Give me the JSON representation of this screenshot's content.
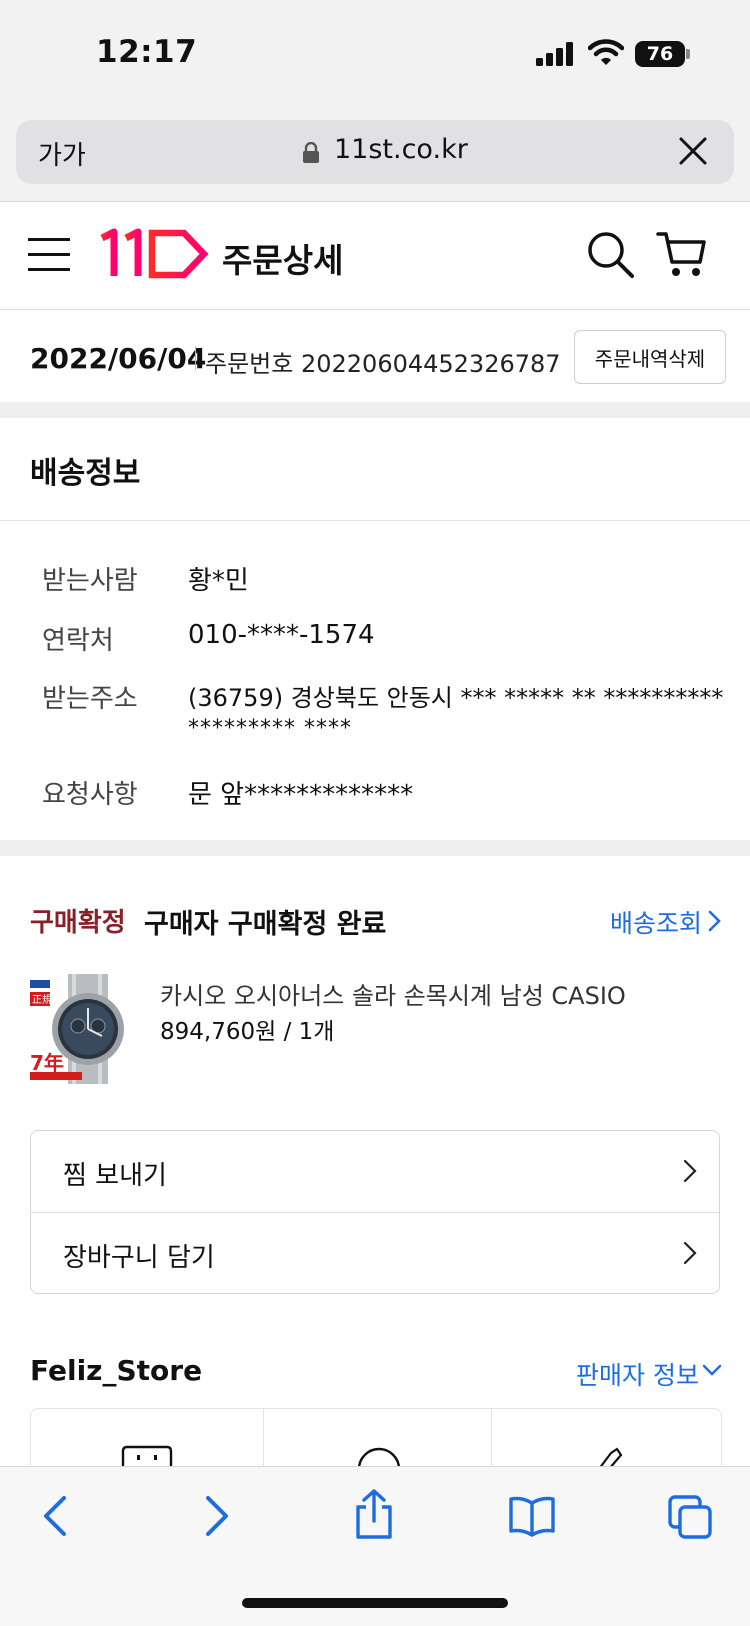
{
  "status": {
    "time": "12:17",
    "battery": "76"
  },
  "browser": {
    "text_size": "가가",
    "url": "11st.co.kr"
  },
  "header": {
    "title": "주문상세"
  },
  "order": {
    "date": "2022/06/04",
    "number_label": "주문번호",
    "number": "20220604452326787",
    "delete_button": "주문내역삭제"
  },
  "delivery": {
    "heading": "배송정보",
    "recipient_label": "받는사람",
    "recipient": "황*민",
    "phone_label": "연락처",
    "phone": "010-****-1574",
    "address_label": "받는주소",
    "address_line1": "(36759) 경상북도 안동시 *** ***** ** **********",
    "address_line2": "********* ****",
    "request_label": "요청사항",
    "request": "문 앞*************"
  },
  "purchase": {
    "tag": "구매확정",
    "status": "구매자 구매확정 완료",
    "track_link": "배송조회",
    "product_name": "카시오 오시아너스 솔라 손목시계 남성 CASIO",
    "product_price": "894,760원 / 1개",
    "thumb_text_top": "正規",
    "thumb_text_bottom": "7年",
    "actions": [
      "찜 보내기",
      "장바구니 담기"
    ]
  },
  "seller": {
    "store_name": "Feliz_Store",
    "info_link": "판매자 정보"
  },
  "colors": {
    "accent_blue": "#1d6de0",
    "tag_red": "#8a1f28",
    "logo_red": "#ff1f3a",
    "logo_pink": "#ff0073"
  }
}
